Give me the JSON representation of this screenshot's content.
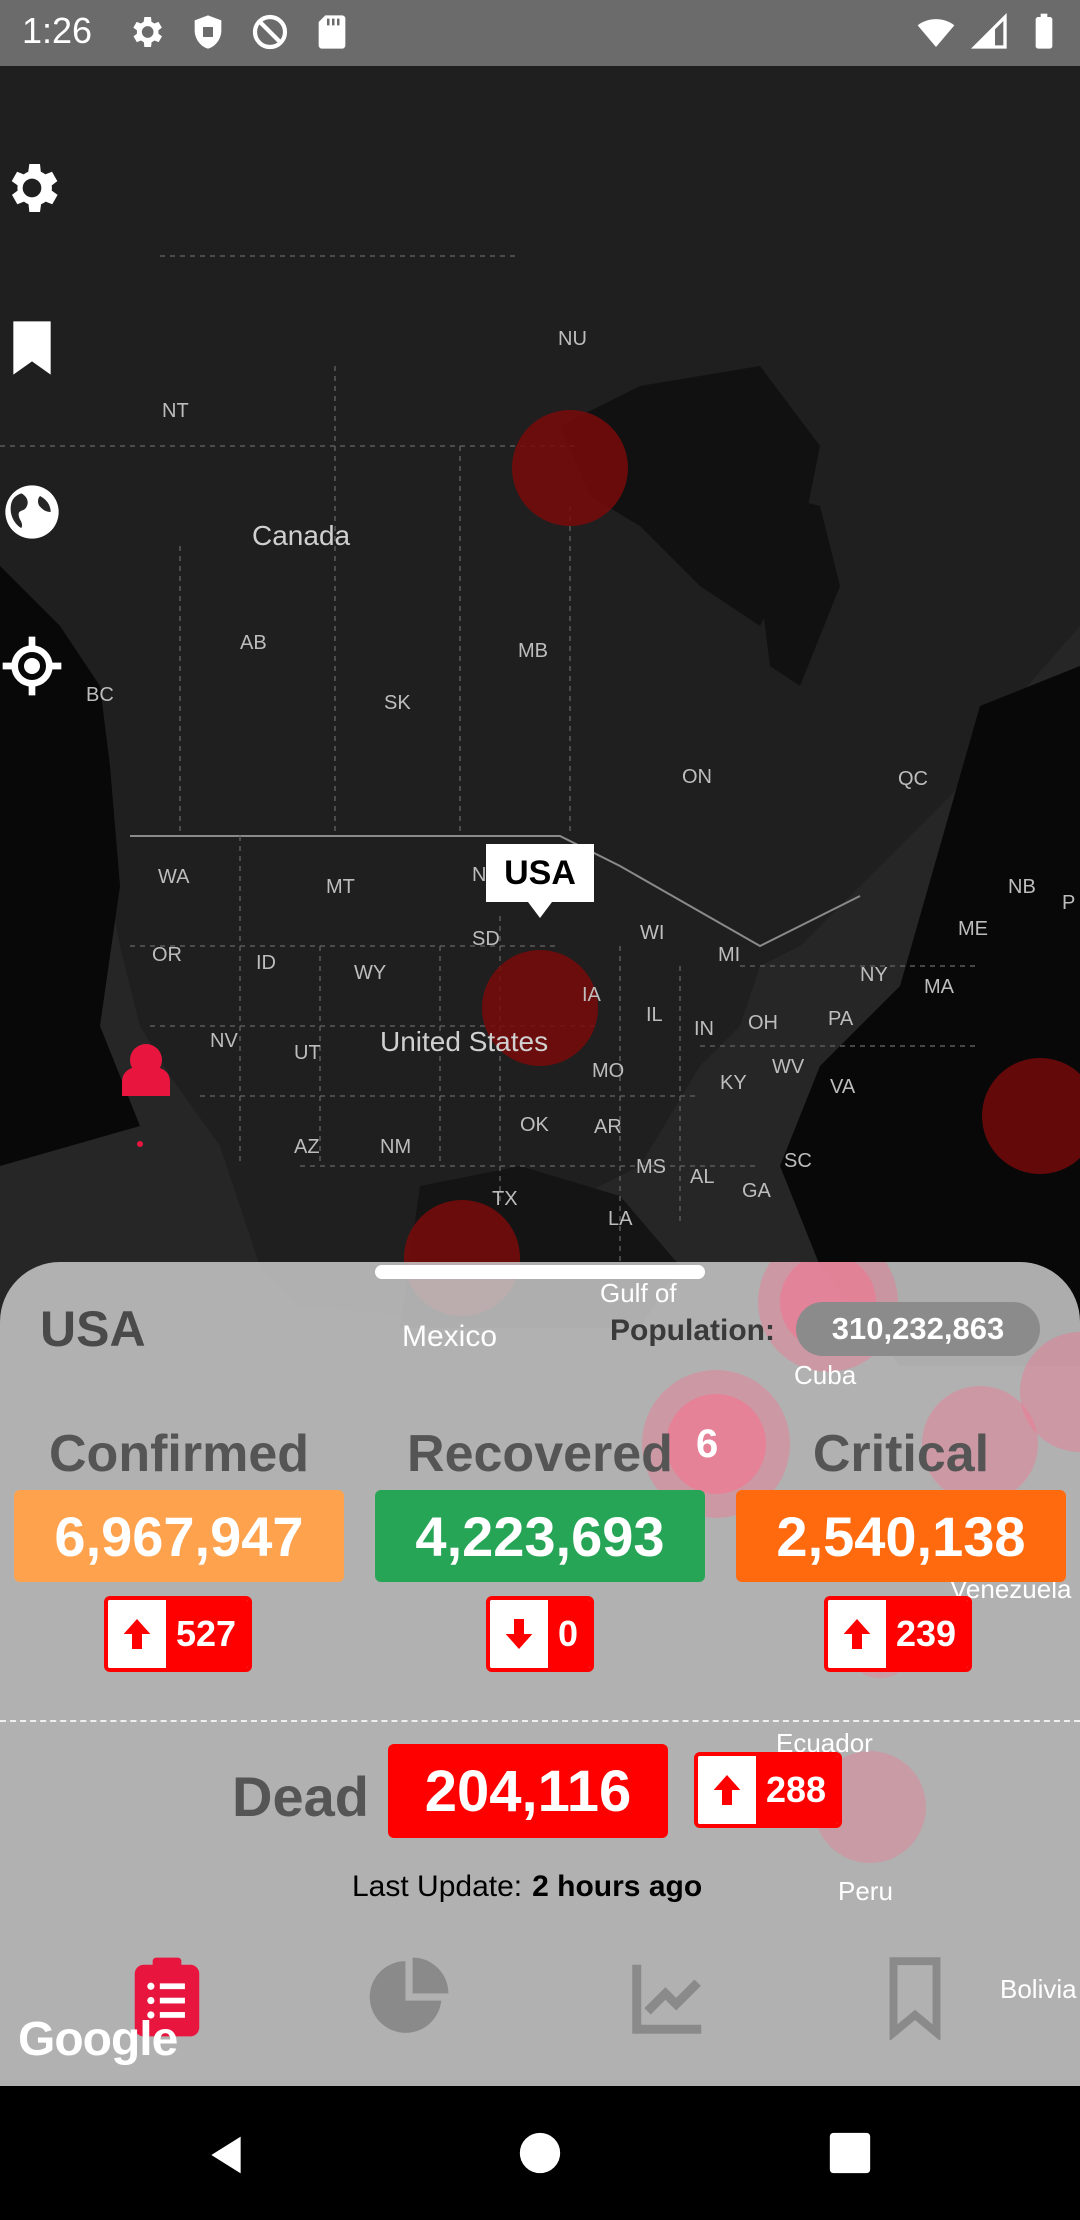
{
  "status_bar": {
    "time": "1:26"
  },
  "map": {
    "labels": {
      "nu": "NU",
      "nt": "NT",
      "canada": "Canada",
      "ab": "AB",
      "mb": "MB",
      "bc": "BC",
      "sk": "SK",
      "on": "ON",
      "qc": "QC",
      "nb": "NB",
      "wa": "WA",
      "mt": "MT",
      "nd": "N",
      "sd": "SD",
      "wi": "WI",
      "mi": "MI",
      "ny": "NY",
      "me": "ME",
      "ma": "MA",
      "or": "OR",
      "id": "ID",
      "wy": "WY",
      "ia": "IA",
      "il": "IL",
      "in": "IN",
      "oh": "OH",
      "pa": "PA",
      "nv": "NV",
      "ut": "UT",
      "united_states": "United States",
      "mo": "MO",
      "wv": "WV",
      "ky": "KY",
      "va": "VA",
      "ok": "OK",
      "ar": "AR",
      "az": "AZ",
      "nm": "NM",
      "ms": "MS",
      "al": "AL",
      "ga": "GA",
      "sc": "SC",
      "tx": "TX",
      "la": "LA",
      "gulf": "Gulf of",
      "mexico": "Mexico",
      "cuba": "Cuba",
      "venezuela": "Venezuela",
      "ecuador": "Ecuador",
      "peru": "Peru",
      "bolivia": "Bolivia",
      "p": "P"
    },
    "cluster_count": "6",
    "tooltip": "USA",
    "attribution": "Google"
  },
  "panel": {
    "country": "USA",
    "population_label": "Population:",
    "population": "310,232,863",
    "confirmed": {
      "label": "Confirmed",
      "value": "6,967,947",
      "delta": "527",
      "color": "#ffa24d"
    },
    "recovered": {
      "label": "Recovered",
      "value": "4,223,693",
      "delta": "0",
      "color": "#27a556"
    },
    "critical": {
      "label": "Critical",
      "value": "2,540,138",
      "delta": "239",
      "color": "#ff6a0f"
    },
    "dead": {
      "label": "Dead",
      "value": "204,116",
      "delta": "288",
      "color": "#ff0000"
    },
    "last_update_label": "Last Update:",
    "last_update_value": "2 hours ago"
  },
  "bottom_nav": [
    "summary",
    "pie-chart",
    "trend",
    "bookmarks"
  ]
}
